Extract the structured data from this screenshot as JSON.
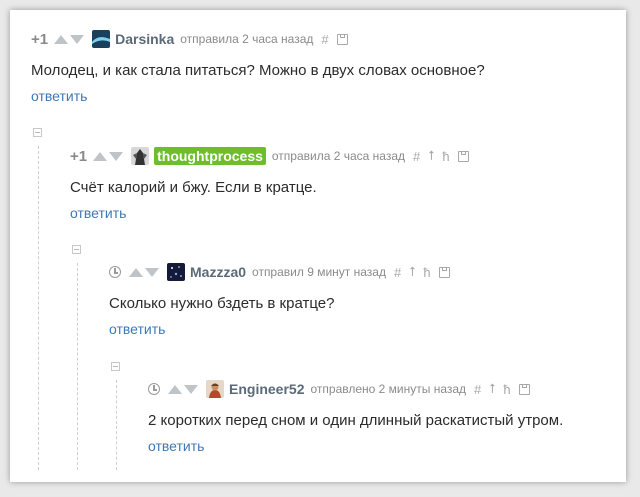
{
  "comments": [
    {
      "rating": "+1",
      "author": "Darsinka",
      "meta": "отправила 2 часа назад",
      "text": "Молодец, и как стала питаться? Можно в двух словах основное?",
      "reply": "ответить"
    },
    {
      "rating": "+1",
      "author": "thoughtprocess",
      "meta": "отправила 2 часа назад",
      "text": "Счёт калорий и бжу. Если в кратце.",
      "reply": "ответить"
    },
    {
      "author": "Mazzza0",
      "meta": "отправил 9 минут назад",
      "text": "Сколько нужно бздеть в кратце?",
      "reply": "ответить"
    },
    {
      "author": "Engineer52",
      "meta": "отправлено 2 минуты назад",
      "text": "2 коротких перед сном и один длинный раскатистый утром.",
      "reply": "ответить"
    }
  ],
  "icons": {
    "hash": "#",
    "parent": "⭡",
    "branch": "ħ"
  },
  "colors": {
    "highlight_nick": "#6cbe2d",
    "link": "#3d78b5"
  }
}
